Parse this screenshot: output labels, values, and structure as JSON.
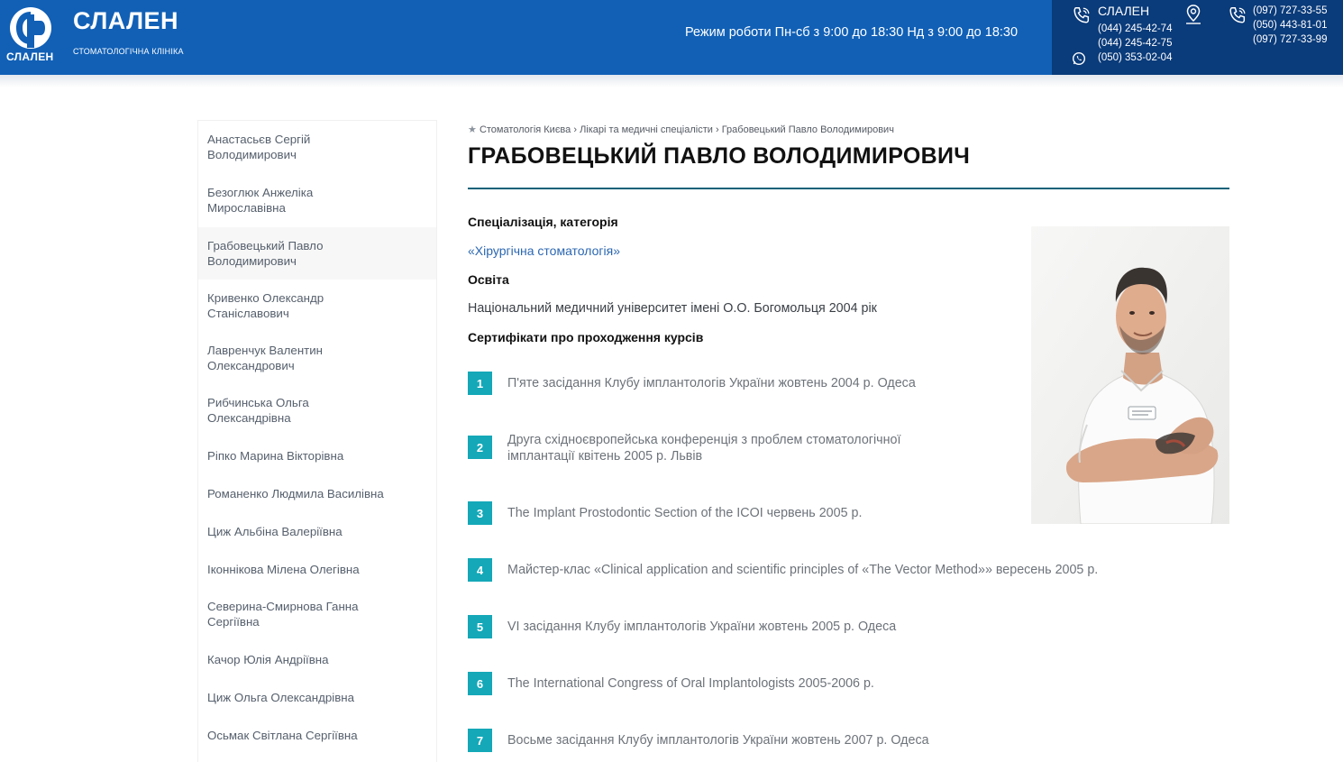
{
  "header": {
    "logo_text": "СЛАЛЕН",
    "brand_name": "СЛАЛЕН",
    "brand_subtitle": "СТОМАТОЛОГІЧНА КЛІНІКА",
    "schedule": "Режим роботи Пн-сб з 9:00 до 18:30 Нд з 9:00 до 18:30",
    "contacts": {
      "title": "СЛАЛЕН",
      "phones_left": [
        "(044) 245-42-74",
        "(044) 245-42-75"
      ],
      "whatsapp": "(050) 353-02-04",
      "phones_right": [
        "(097) 727-33-55",
        "(050) 443-81-01",
        "(097) 727-33-99"
      ]
    },
    "colors": {
      "primary": "#1160b6",
      "dark": "#0a3b7a"
    }
  },
  "sidebar": {
    "items": [
      {
        "label": "Анастасьєв Сергій\nВолодимирович",
        "active": false
      },
      {
        "label": "Безоглюк Анжеліка\nМирославівна",
        "active": false
      },
      {
        "label": "Грабовецький Павло\nВолодимирович",
        "active": true
      },
      {
        "label": "Кривенко Олександр\nСтаніславович",
        "active": false
      },
      {
        "label": "Лавренчук Валентин\nОлександрович",
        "active": false
      },
      {
        "label": "Рибчинська Ольга\nОлександрівна",
        "active": false
      },
      {
        "label": "Ріпко Марина Вікторівна",
        "active": false
      },
      {
        "label": "Романенко Людмила Василівна",
        "active": false
      },
      {
        "label": "Циж Альбіна Валеріївна",
        "active": false
      },
      {
        "label": "Іконнікова Мілена Олегівна",
        "active": false
      },
      {
        "label": "Северина-Смирнова Ганна\nСергіївна",
        "active": false
      },
      {
        "label": "Качор Юлія Андріївна",
        "active": false
      },
      {
        "label": "Циж Ольга Олександрівна",
        "active": false
      },
      {
        "label": "Осьмак Світлана Сергіївна",
        "active": false
      }
    ]
  },
  "breadcrumb": {
    "icon": "star-icon",
    "items": [
      "Стоматологія Києва",
      "Лікарі та медичні спеціалісти",
      "Грабовецький Павло Володимирович"
    ],
    "separator": "›"
  },
  "doctor": {
    "name": "ГРАБОВЕЦЬКИЙ ПАВЛО ВОЛОДИМИРОВИЧ",
    "specialization_heading": "Спеціалізація, категорія",
    "specialization": "«Хірургічна стоматологія»",
    "education_heading": "Освіта",
    "education": "Національний медичний університет імені О.О. Богомольця 2004 рік",
    "certificates_heading": "Сертифікати про проходження курсів",
    "certificates": [
      {
        "num": "1",
        "text": "П'яте засідання Клубу імплантологів України жовтень 2004 р. Одеса"
      },
      {
        "num": "2",
        "text": "Друга східноєвропейська конференція з проблем стоматологічної\nімплантації квітень 2005 р. Львів"
      },
      {
        "num": "3",
        "text": "The Implant Prostodontic Section of the ICOI червень 2005 р."
      },
      {
        "num": "4",
        "text": "Майстер-клас «Clinical application and scientific principles of «The Vector Method»» вересень 2005 р."
      },
      {
        "num": "5",
        "text": "VI засідання Клубу імплантологів України жовтень 2005 р. Одеса"
      },
      {
        "num": "6",
        "text": "The International Congress of Oral Implantologists 2005-2006 р."
      },
      {
        "num": "7",
        "text": "Восьме засідання Клубу імплантологів України жовтень 2007 р. Одеса"
      }
    ],
    "accent_color": "#14a8b8"
  }
}
